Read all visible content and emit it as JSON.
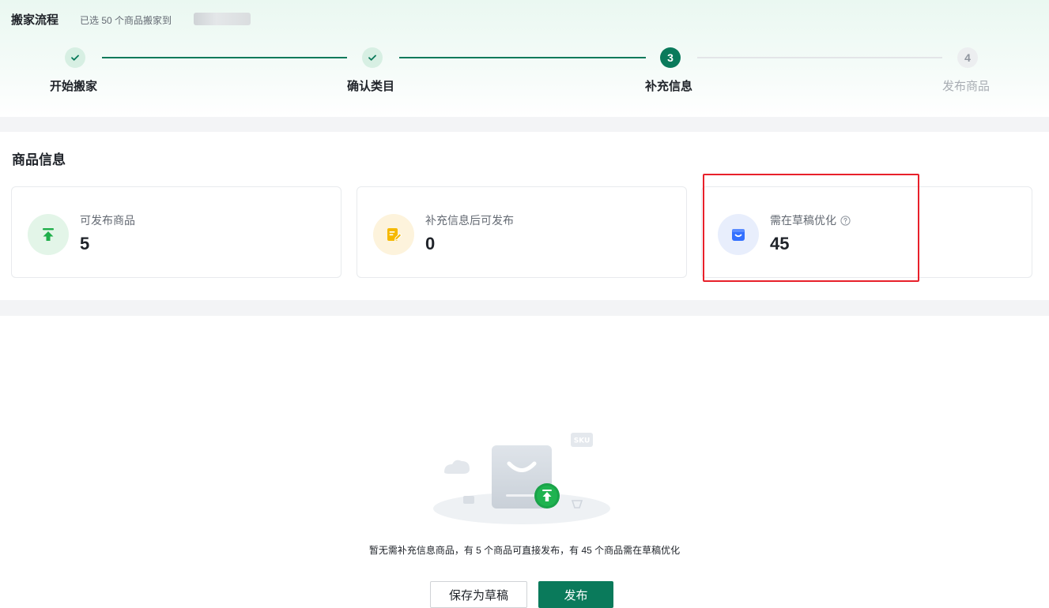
{
  "header": {
    "title": "搬家流程",
    "subtitle": "已选 50 个商品搬家到"
  },
  "steps": [
    {
      "number": "1",
      "label": "开始搬家",
      "status": "done"
    },
    {
      "number": "2",
      "label": "确认类目",
      "status": "done"
    },
    {
      "number": "3",
      "label": "补充信息",
      "status": "current"
    },
    {
      "number": "4",
      "label": "发布商品",
      "status": "todo"
    }
  ],
  "product_info": {
    "title": "商品信息",
    "cards": [
      {
        "label": "可发布商品",
        "value": "5",
        "icon": "upload-icon",
        "icon_color": "#1fae4a",
        "icon_bg": "#e3f5e8"
      },
      {
        "label": "补充信息后可发布",
        "value": "0",
        "icon": "edit-note-icon",
        "icon_color": "#f5b800",
        "icon_bg": "#fdf3dc"
      },
      {
        "label": "需在草稿优化",
        "value": "45",
        "icon": "draft-box-icon",
        "icon_color": "#3370ff",
        "icon_bg": "#e8eefc"
      }
    ]
  },
  "result": {
    "message": "暂无需补充信息商品，有 5 个商品可直接发布，有 45 个商品需在草稿优化",
    "illustration_badge": "SKU"
  },
  "actions": {
    "save_draft": "保存为草稿",
    "publish": "发布"
  },
  "colors": {
    "brand": "#0a7a5b",
    "highlight": "#e8202a"
  }
}
